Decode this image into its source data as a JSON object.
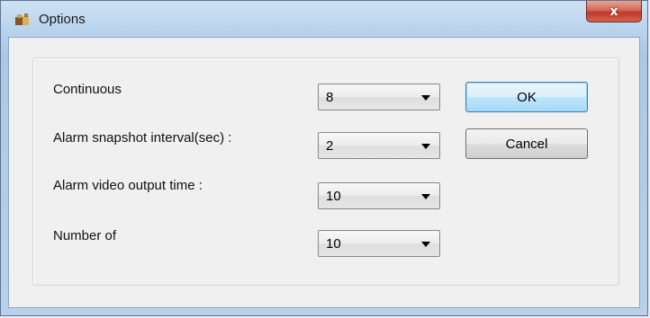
{
  "window": {
    "title": "Options",
    "close_glyph": "x"
  },
  "fields": [
    {
      "label": "Continuous",
      "value": "8"
    },
    {
      "label": "Alarm snapshot interval(sec) :",
      "value": "2"
    },
    {
      "label": "Alarm video output time :",
      "value": "10"
    },
    {
      "label": "Number of",
      "value": "10"
    }
  ],
  "buttons": {
    "ok": "OK",
    "cancel": "Cancel"
  },
  "icons": {
    "app": "app-puzzle-icon",
    "close": "close-icon",
    "dropdown": "chevron-down-icon"
  },
  "colors": {
    "close_button": "#c0392b",
    "default_button_border": "#3c7fb1"
  }
}
